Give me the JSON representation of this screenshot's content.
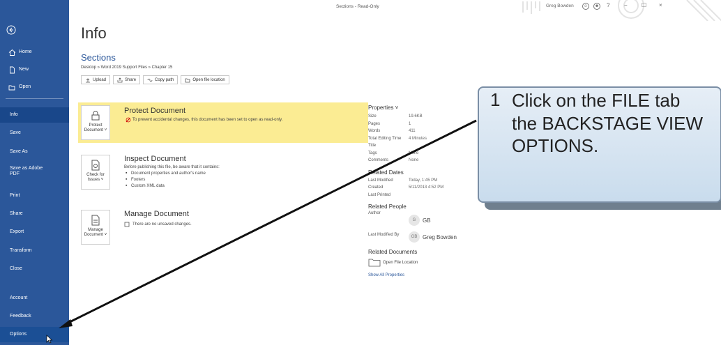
{
  "window": {
    "title": "Sections  -  Read-Only",
    "user": "Greg Bowden",
    "help": "?",
    "minimize": "−",
    "maximize": "☐",
    "close": "×",
    "user_icons": [
      "☺",
      "☻"
    ]
  },
  "sidebar": {
    "top_items": [
      {
        "label": "Home",
        "icon": "home-icon"
      },
      {
        "label": "New",
        "icon": "new-document-icon"
      },
      {
        "label": "Open",
        "icon": "folder-open-icon"
      }
    ],
    "items": [
      {
        "label": "Info"
      },
      {
        "label": "Save"
      },
      {
        "label": "Save As"
      },
      {
        "label": "Save as Adobe PDF"
      },
      {
        "label": "Print"
      },
      {
        "label": "Share"
      },
      {
        "label": "Export"
      },
      {
        "label": "Transform"
      },
      {
        "label": "Close"
      }
    ],
    "bottom_items": [
      {
        "label": "Account"
      },
      {
        "label": "Feedback"
      },
      {
        "label": "Options"
      }
    ]
  },
  "header": {
    "title": "Info",
    "doc_name": "Sections",
    "breadcrumb": "Desktop » Word 2019 Support Files » Chapter 15",
    "actions": [
      "Upload",
      "Share",
      "Copy path",
      "Open file location"
    ]
  },
  "sections": {
    "protect": {
      "tile": "Protect Document ˅",
      "heading": "Protect Document",
      "text": "To prevent accidental changes, this document has been set to open as read-only."
    },
    "inspect": {
      "tile": "Check for Issues ˅",
      "heading": "Inspect Document",
      "intro": "Before publishing this file, be aware that it contains:",
      "bullets": [
        "Document properties and author's name",
        "Footers",
        "Custom XML data"
      ]
    },
    "manage": {
      "tile": "Manage Document ˅",
      "heading": "Manage Document",
      "text": "There are no unsaved changes."
    }
  },
  "properties": {
    "heading": "Properties ˅",
    "rows": [
      {
        "k": "Size",
        "v": "19.6KB"
      },
      {
        "k": "Pages",
        "v": "1"
      },
      {
        "k": "Words",
        "v": "411"
      },
      {
        "k": "Total Editing Time",
        "v": "4 Minutes"
      },
      {
        "k": "Title",
        "v": ""
      },
      {
        "k": "Tags",
        "v": "None"
      },
      {
        "k": "Comments",
        "v": "None"
      }
    ],
    "dates_heading": "Related Dates",
    "dates": [
      {
        "k": "Last Modified",
        "v": "Today, 1:45 PM"
      },
      {
        "k": "Created",
        "v": "5/11/2013 4:52 PM"
      },
      {
        "k": "Last Printed",
        "v": ""
      }
    ],
    "people_heading": "Related People",
    "author_label": "Author",
    "author_initials": "G",
    "author_name": "GB",
    "modified_by_label": "Last Modified By",
    "modified_by_initials": "GB",
    "modified_by_name": "Greg Bowden",
    "docs_heading": "Related Documents",
    "open_location": "Open File Location",
    "show_all": "Show All Properties"
  },
  "callout": {
    "number": "1",
    "text": "Click on the FILE tab\nthe BACKSTAGE VIEW\nOPTIONS."
  },
  "colors": {
    "sidebar": "#2b579a",
    "callout": "#c9dced",
    "protect_bg": "#fbec93"
  }
}
